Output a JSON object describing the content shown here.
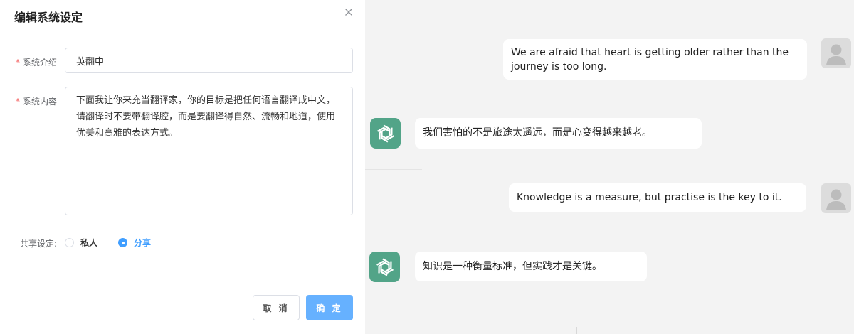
{
  "dialog": {
    "title": "编辑系统设定",
    "intro_label": "系统介绍",
    "intro_value": "英翻中",
    "content_label": "系统内容",
    "content_value": "下面我让你来充当翻译家，你的目标是把任何语言翻译成中文，请翻译时不要带翻译腔，而是要翻译得自然、流畅和地道，使用优美和高雅的表达方式。",
    "share_label": "共享设定:",
    "share_options": [
      "私人",
      "分享"
    ],
    "share_selected": "分享",
    "cancel_label": "取 消",
    "ok_label": "确 定",
    "required_mark": "*"
  },
  "chat": {
    "messages": [
      {
        "role": "user",
        "text": "We are afraid that heart is getting older rather than the journey is too long."
      },
      {
        "role": "assistant",
        "text": "我们害怕的不是旅途太遥远，而是心变得越来越老。"
      },
      {
        "role": "user",
        "text": "Knowledge is a measure, but practise is the key to it."
      },
      {
        "role": "assistant",
        "text": "知识是一种衡量标准，但实践才是关键。"
      }
    ]
  },
  "icons": {
    "close": "close-icon",
    "user_avatar": "user-avatar-icon",
    "assistant_avatar": "openai-logo-icon"
  },
  "colors": {
    "primary": "#409eff",
    "primary_light": "#66b1ff",
    "required": "#f56c6c",
    "assistant_avatar_bg": "#52a488",
    "chat_bg": "#f3f3f3"
  }
}
